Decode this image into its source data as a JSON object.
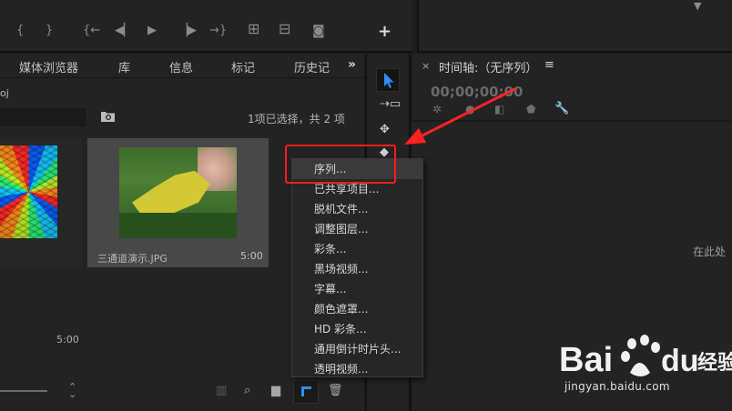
{
  "source_monitor": {
    "controls": [
      {
        "name": "mark-in-icon",
        "glyph": "{"
      },
      {
        "name": "mark-out-icon",
        "glyph": "}"
      },
      {
        "name": "go-to-in-icon",
        "glyph": "{←"
      },
      {
        "name": "step-back-icon",
        "glyph": "◀▏"
      },
      {
        "name": "play-icon",
        "glyph": "▶"
      },
      {
        "name": "step-forward-icon",
        "glyph": "▕▶"
      },
      {
        "name": "go-to-out-icon",
        "glyph": "→}"
      },
      {
        "name": "insert-icon",
        "glyph": "⊞"
      },
      {
        "name": "overwrite-icon",
        "glyph": "⊟"
      },
      {
        "name": "camera-icon",
        "glyph": "◙"
      }
    ],
    "add_button": "+"
  },
  "project_panel": {
    "tabs": [
      "媒体浏览器",
      "库",
      "信息",
      "标记",
      "历史记"
    ],
    "overflow": "»",
    "project_name": "oj",
    "selection_status": "1项已选择，共 2 项",
    "items": [
      {
        "label": "",
        "duration": "5:00"
      },
      {
        "label": "三通道演示.JPG",
        "duration": "5:00"
      }
    ]
  },
  "timeline": {
    "close": "×",
    "title": "时间轴:（无序列）",
    "menu": "≡",
    "timecode": "00;00;00;00",
    "drop_hint": "在此处"
  },
  "context_menu": {
    "items": [
      "序列...",
      "已共享项目...",
      "脱机文件...",
      "调整图层...",
      "彩条...",
      "黑场视频...",
      "字幕...",
      "颜色遮罩...",
      "HD 彩条...",
      "通用倒计时片头...",
      "透明视频..."
    ],
    "hovered_index": 0
  },
  "annotation": {
    "color": "#ff1b1b"
  },
  "watermark": {
    "text": "Bai du 经验",
    "url": "jingyan.baidu.com"
  }
}
